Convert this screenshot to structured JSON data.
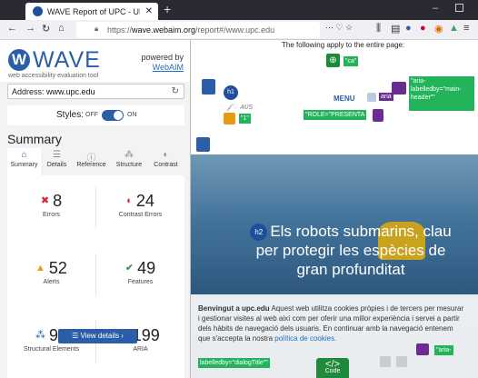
{
  "browser": {
    "tab_title": "WAVE Report of UPC - UPC Un",
    "tab_close": "✕",
    "new_tab": "+",
    "url_host": "wave.webaim.org",
    "url_prefix": "https://",
    "url_path": "/report#/www.upc.edu",
    "url_more": "··· ♡ ☆"
  },
  "panel": {
    "logo_letter": "W",
    "brand": "WAVE",
    "tagline": "web accessibility evaluation tool",
    "powered_by": "powered by",
    "powered_link": "WebAIM",
    "address_label": "Address:",
    "address_value": "www.upc.edu",
    "styles_label": "Styles:",
    "styles_off": "OFF",
    "styles_on": "ON",
    "summary_title": "Summary",
    "tabs": [
      "Summary",
      "Details",
      "Reference",
      "Structure",
      "Contrast"
    ],
    "metrics": [
      {
        "count": "8",
        "label": "Errors",
        "icon": "✖",
        "color": "#d8232a"
      },
      {
        "count": "24",
        "label": "Contrast Errors",
        "icon": "◐",
        "color": "#d8232a"
      },
      {
        "count": "52",
        "label": "Alerts",
        "icon": "▲",
        "color": "#e89a12"
      },
      {
        "count": "49",
        "label": "Features",
        "icon": "✔",
        "color": "#208a3c"
      },
      {
        "count": "90",
        "label": "Structural Elements",
        "icon": "⁂",
        "color": "#2c5ea8"
      },
      {
        "count": "199",
        "label": "ARIA",
        "icon": "◆",
        "color": "#6a2c91"
      }
    ],
    "view_details": "View details ›"
  },
  "page": {
    "applies_text": "The following apply to the entire page:",
    "ca_tag": "\"ca\"",
    "aria_header_tag": "\"aria-labelledby=\"main-header\"\"",
    "menu_label": "MENU",
    "aria_small": "aria",
    "role_tag": "\"ROLE=\"PRESENTA",
    "num_tag": "\"1\"",
    "h1_label": "h1",
    "h2_label": "h2",
    "headline": "Els robots submarins, clau per protegir les espècies de gran profunditat",
    "cookie_title": "Benvingut a upc.edu",
    "cookie_body": " Aquest web utilitza cookies pròpies i de tercers per mesurar i gestionar visites al web així com per oferir una millor experiència i servei a partir dels hàbits de navegació dels usuaris. En continuar amb la navegació entenem que s'accepta la nostra",
    "cookie_link": "política de cookies.",
    "aria_cookie_tag": "\"aria-",
    "dialog_tag": "labelledby=\"dialogTitle\"\"",
    "code_label": "Code",
    "code_brackets": "</>"
  }
}
